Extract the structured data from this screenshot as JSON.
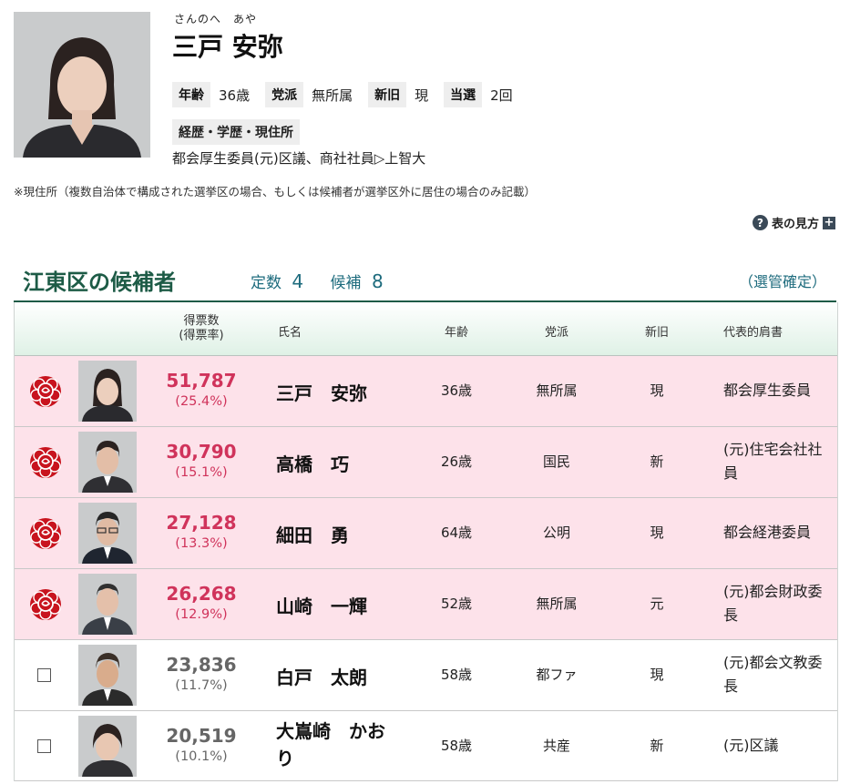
{
  "profile": {
    "ruby": "さんのへ　あや",
    "name": "三戸 安弥",
    "age_label": "年齢",
    "age": "36歳",
    "party_label": "党派",
    "party": "無所属",
    "status_label": "新旧",
    "status": "現",
    "wins_label": "当選",
    "wins": "2回",
    "history_label": "経歴・学歴・現住所",
    "history": "都会厚生委員(元)区議、商社社員▷上智大"
  },
  "note": "※現住所（複数自治体で構成された選挙区の場合、もしくは候補者が選挙区外に居住の場合のみ記載）",
  "legend_link": "表の見方",
  "district": {
    "title": "江東区の候補者",
    "seats_label": "定数",
    "seats": "4",
    "candidates_label": "候補",
    "candidates": "8",
    "confirmed": "（選管確定）"
  },
  "table": {
    "headers": {
      "votes": "得票数",
      "votes_rate": "(得票率)",
      "name": "氏名",
      "age": "年齢",
      "party": "党派",
      "status": "新旧",
      "title": "代表的肩書"
    },
    "rows": [
      {
        "votes": "51,787",
        "rate": "(25.4%)",
        "name_a": "三戸　安弥",
        "name_b": "",
        "age": "36歳",
        "party": "無所属",
        "status": "現",
        "title": "都会厚生委員"
      },
      {
        "votes": "30,790",
        "rate": "(15.1%)",
        "name_a": "高橋　巧",
        "name_b": "",
        "age": "26歳",
        "party": "国民",
        "status": "新",
        "title": "(元)住宅会社社員"
      },
      {
        "votes": "27,128",
        "rate": "(13.3%)",
        "name_a": "細田　勇",
        "name_b": "",
        "age": "64歳",
        "party": "公明",
        "status": "現",
        "title": "都会経港委員"
      },
      {
        "votes": "26,268",
        "rate": "(12.9%)",
        "name_a": "山崎　一輝",
        "name_b": "",
        "age": "52歳",
        "party": "無所属",
        "status": "元",
        "title": "(元)都会財政委長"
      },
      {
        "votes": "23,836",
        "rate": "(11.7%)",
        "name_a": "白戸　太朗",
        "name_b": "",
        "age": "58歳",
        "party": "都ファ",
        "status": "現",
        "title": "(元)都会文教委長"
      },
      {
        "votes": "20,519",
        "rate": "(10.1%)",
        "name_a": "大嶌崎　かお",
        "name_b": "り",
        "age": "58歳",
        "party": "共産",
        "status": "新",
        "title": "(元)区議"
      }
    ]
  },
  "colors": {
    "elected_bg": "#fde2ea",
    "elected_text": "#d0335b",
    "rose": "#c8141e",
    "heading": "#1d5b46",
    "accent": "#1d6b7d"
  },
  "icons": {
    "elected": "rose-icon",
    "not_elected": "checkbox-icon",
    "help": "question-circle-icon",
    "expand": "plus-icon"
  }
}
